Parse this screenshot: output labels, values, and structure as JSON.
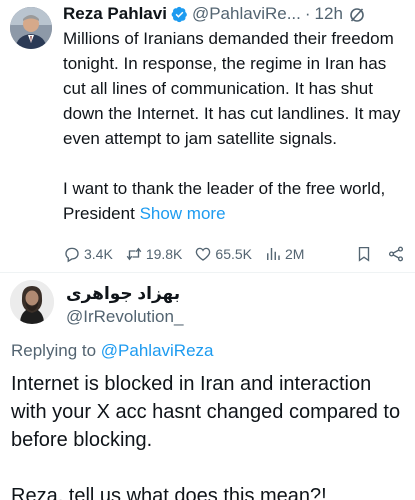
{
  "tweet": {
    "author_name": "Reza Pahlavi",
    "author_handle": "@PahlaviRe...",
    "separator": "·",
    "time": "12h",
    "text_para1": "Millions of Iranians demanded their freedom tonight. In response, the regime in Iran has cut all lines of communication. It has shut down the Internet. It has cut landlines. It may even attempt to jam satellite signals.",
    "text_para2": "I want to thank the leader of the free world, President",
    "show_more": "Show more",
    "stats": {
      "replies": "3.4K",
      "reposts": "19.8K",
      "likes": "65.5K",
      "views": "2M"
    }
  },
  "reply": {
    "author_name": "بهزاد جواهری",
    "author_handle": "@IrRevolution_",
    "replying_prefix": "Replying to",
    "replying_to": "@PahlaviReza",
    "text_para1": "Internet is blocked in Iran and interaction with your X acc hasnt changed compared to before blocking.",
    "text_para2": "Reza, tell us what does this mean?!"
  },
  "colors": {
    "accent": "#1d9bf0",
    "secondary_text": "#536471",
    "primary_text": "#0f1419"
  },
  "icons": [
    "verified-badge-icon",
    "grok-icon",
    "reply-icon",
    "repost-icon",
    "like-icon",
    "views-icon",
    "bookmark-icon",
    "share-icon"
  ]
}
